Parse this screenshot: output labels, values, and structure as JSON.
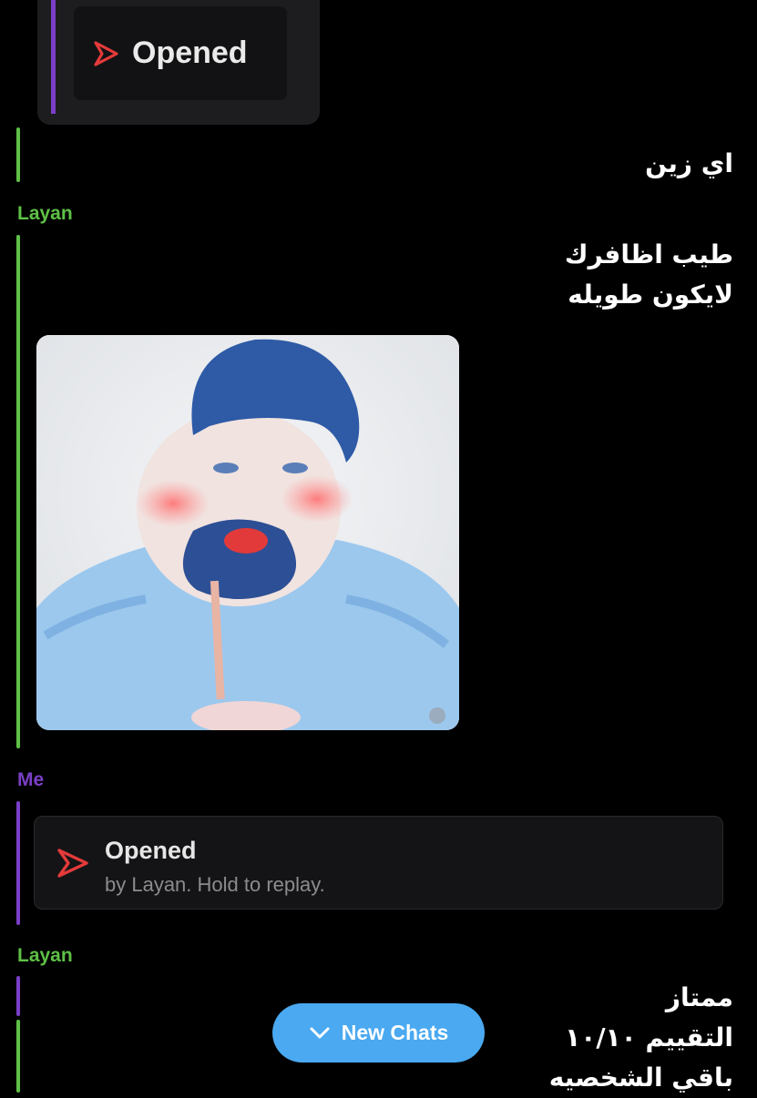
{
  "colors": {
    "friend": "#5ec046",
    "me": "#7a3fc6",
    "snap_red": "#e43a3a",
    "button_blue": "#4aa9f0"
  },
  "top_snap": {
    "label": "Opened",
    "icon": "snap-arrow-icon"
  },
  "messages": [
    {
      "text": "اي زين"
    },
    {
      "sender": "Layan",
      "lines": [
        "طيب اظافرك",
        "لايكون طويله"
      ]
    }
  ],
  "me_block": {
    "sender": "Me",
    "status": "Opened",
    "detail": "by Layan. Hold to replay.",
    "icon": "snap-arrow-icon"
  },
  "last_block": {
    "sender": "Layan",
    "lines": [
      "ممتاز",
      "التقييم ١٠/١٠",
      "باقي الشخصيه"
    ]
  },
  "new_chats": {
    "label": "New Chats",
    "icon": "chevron-down-icon"
  }
}
